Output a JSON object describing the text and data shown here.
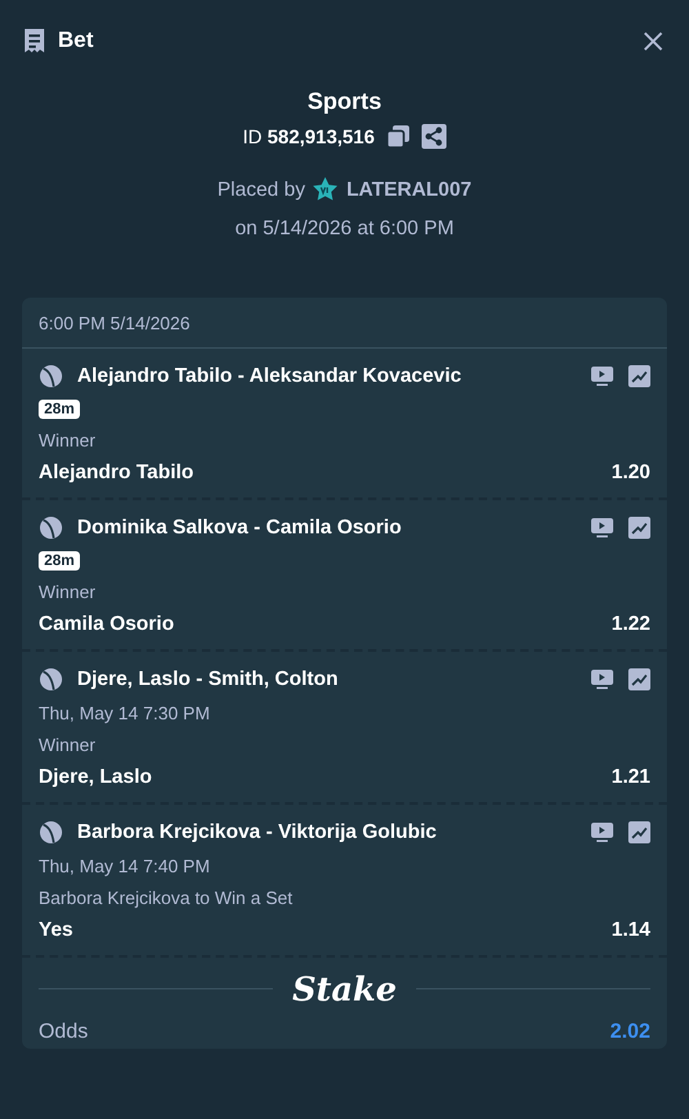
{
  "header": {
    "title": "Bet"
  },
  "summary": {
    "category": "Sports",
    "id_label": "ID",
    "id_value": "582,913,516",
    "placed_by_label": "Placed by",
    "user": "LATERAL007",
    "placed_on": "on 5/14/2026 at 6:00 PM"
  },
  "slip": {
    "timestamp": "6:00 PM 5/14/2026",
    "legs": [
      {
        "event": "Alejandro Tabilo - Aleksandar Kovacevic",
        "kind": "live",
        "status": "28m",
        "market": "Winner",
        "selection": "Alejandro Tabilo",
        "odds": "1.20"
      },
      {
        "event": "Dominika Salkova - Camila Osorio",
        "kind": "live",
        "status": "28m",
        "market": "Winner",
        "selection": "Camila Osorio",
        "odds": "1.22"
      },
      {
        "event": "Djere, Laslo - Smith, Colton",
        "kind": "scheduled",
        "status": "Thu, May 14  7:30 PM",
        "market": "Winner",
        "selection": "Djere, Laslo",
        "odds": "1.21"
      },
      {
        "event": "Barbora Krejcikova - Viktorija Golubic",
        "kind": "scheduled",
        "status": "Thu, May 14  7:40 PM",
        "market": "Barbora Krejcikova to Win a Set",
        "selection": "Yes",
        "odds": "1.14"
      }
    ],
    "brand": "Stake",
    "totals": [
      {
        "label": "Odds",
        "value": "2.02"
      }
    ]
  }
}
